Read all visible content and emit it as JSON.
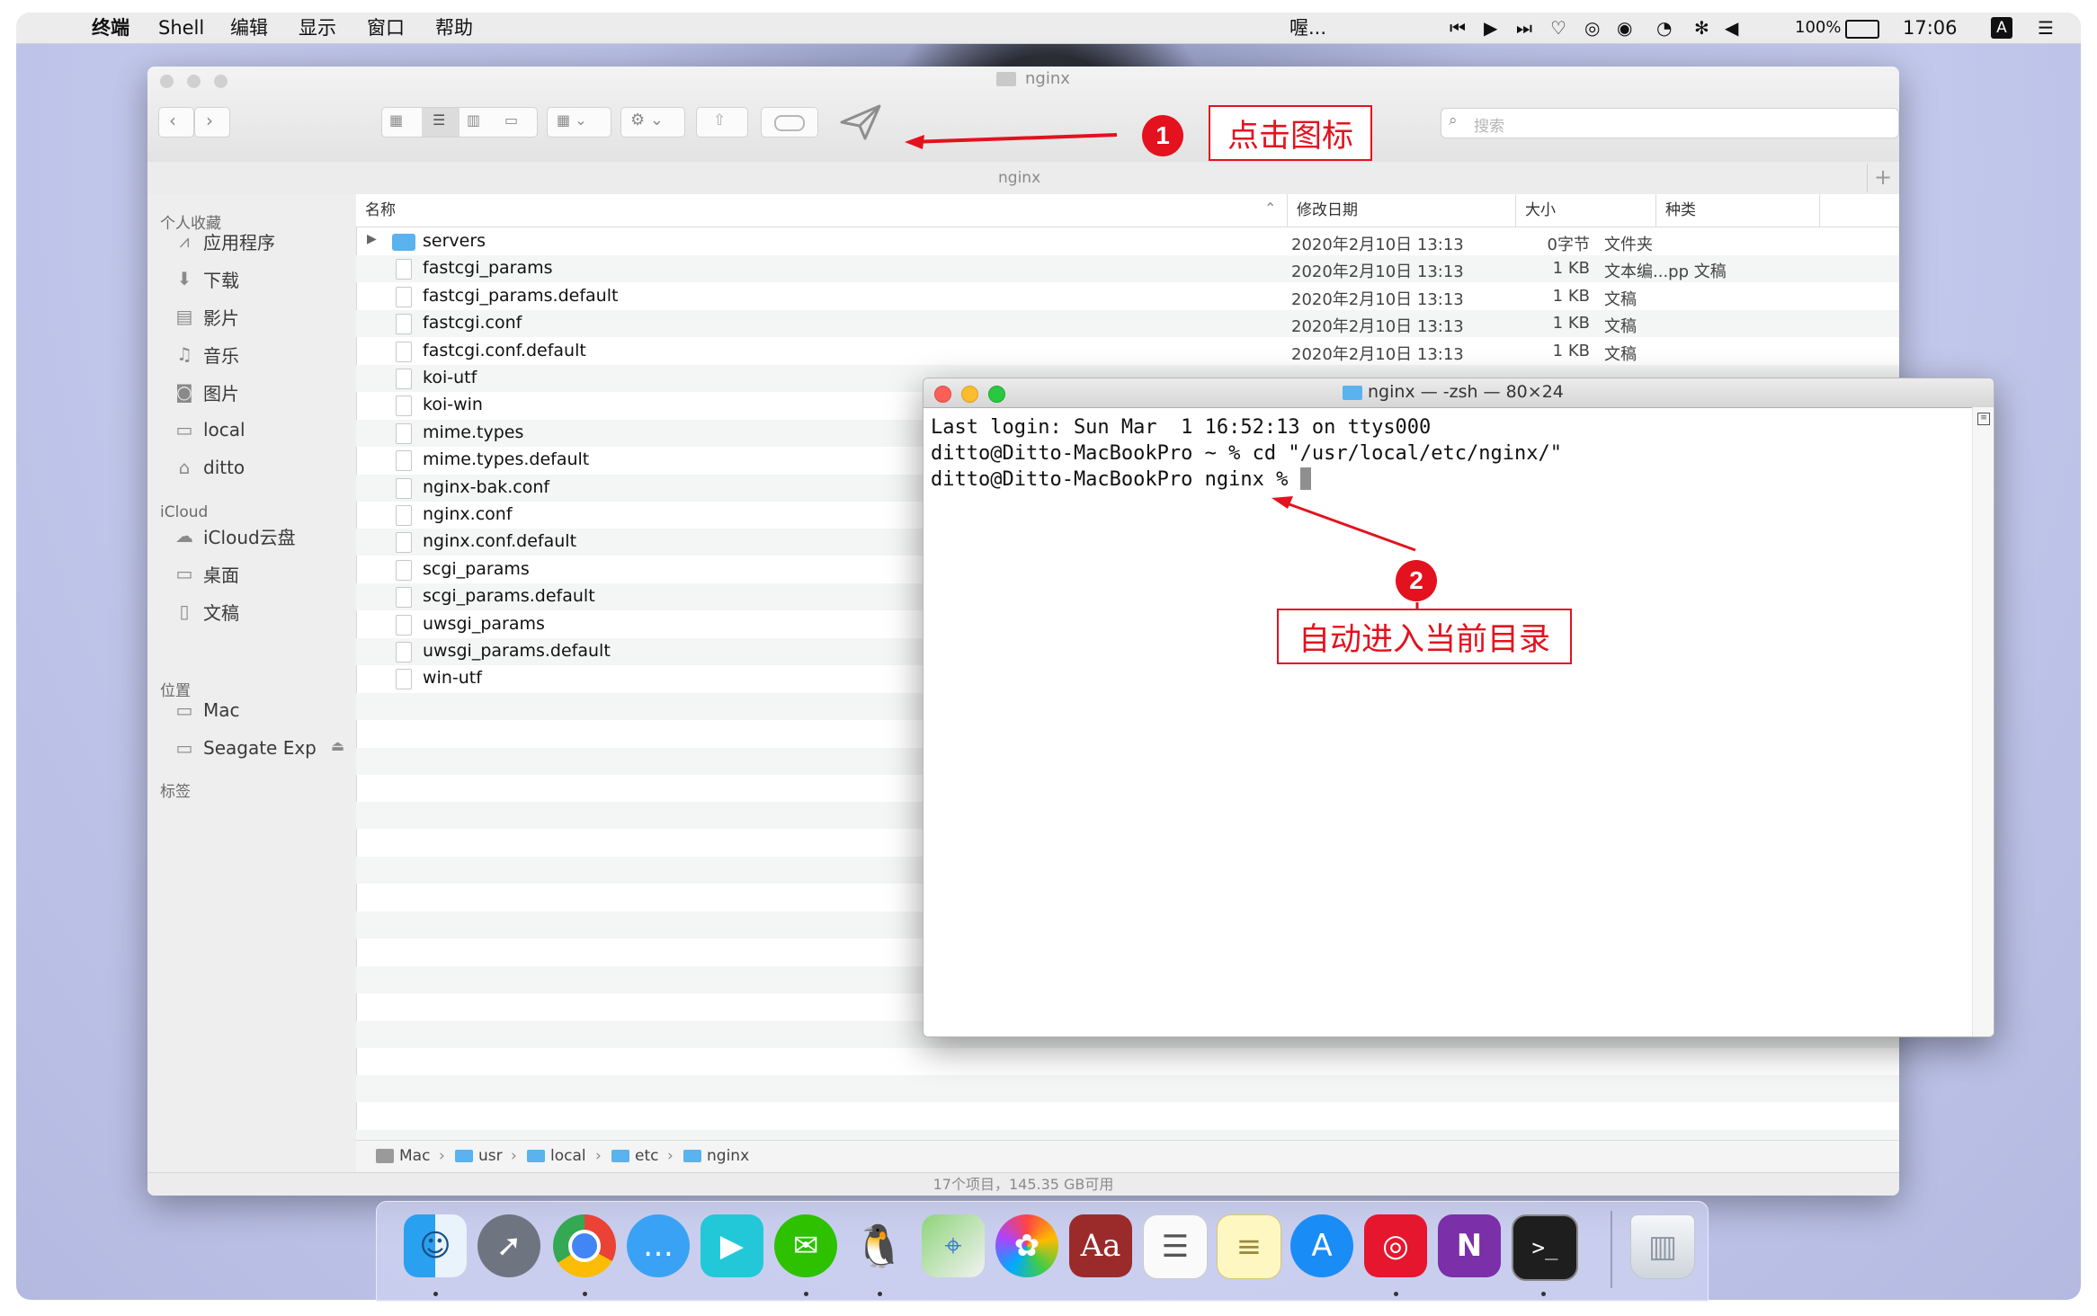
{
  "menubar": {
    "app_name": "终端",
    "menus": [
      "Shell",
      "编辑",
      "显示",
      "窗口",
      "帮助"
    ],
    "now_playing": "喔...",
    "battery": "100%",
    "clock": "17:06",
    "input_method": "A"
  },
  "finder": {
    "window_title": "nginx",
    "path_title": "nginx",
    "search_placeholder": "搜索",
    "sidebar": {
      "favorites_header": "个人收藏",
      "favorites": [
        {
          "label": "应用程序",
          "icon": "applications-icon"
        },
        {
          "label": "下载",
          "icon": "download-icon"
        },
        {
          "label": "影片",
          "icon": "movies-icon"
        },
        {
          "label": "音乐",
          "icon": "music-icon"
        },
        {
          "label": "图片",
          "icon": "camera-icon"
        },
        {
          "label": "local",
          "icon": "folder-icon"
        },
        {
          "label": "ditto",
          "icon": "home-icon"
        }
      ],
      "icloud_header": "iCloud",
      "icloud": [
        {
          "label": "iCloud云盘",
          "icon": "cloud-icon"
        },
        {
          "label": "桌面",
          "icon": "desktop-icon"
        },
        {
          "label": "文稿",
          "icon": "documents-icon"
        }
      ],
      "locations_header": "位置",
      "locations": [
        {
          "label": "Mac",
          "icon": "disk-icon"
        },
        {
          "label": "Seagate Exp",
          "icon": "external-disk-icon"
        }
      ],
      "tags_header": "标签"
    },
    "columns": {
      "name": "名称",
      "date": "修改日期",
      "size": "大小",
      "kind": "种类"
    },
    "files": [
      {
        "name": "servers",
        "date": "2020年2月10日 13:13",
        "size": "0字节",
        "kind": "文件夹",
        "folder": true
      },
      {
        "name": "fastcgi_params",
        "date": "2020年2月10日 13:13",
        "size": "1 KB",
        "kind": "文本编...pp 文稿"
      },
      {
        "name": "fastcgi_params.default",
        "date": "2020年2月10日 13:13",
        "size": "1 KB",
        "kind": "文稿"
      },
      {
        "name": "fastcgi.conf",
        "date": "2020年2月10日 13:13",
        "size": "1 KB",
        "kind": "文稿"
      },
      {
        "name": "fastcgi.conf.default",
        "date": "2020年2月10日 13:13",
        "size": "1 KB",
        "kind": "文稿"
      },
      {
        "name": "koi-utf"
      },
      {
        "name": "koi-win"
      },
      {
        "name": "mime.types"
      },
      {
        "name": "mime.types.default"
      },
      {
        "name": "nginx-bak.conf"
      },
      {
        "name": "nginx.conf"
      },
      {
        "name": "nginx.conf.default"
      },
      {
        "name": "scgi_params"
      },
      {
        "name": "scgi_params.default"
      },
      {
        "name": "uwsgi_params"
      },
      {
        "name": "uwsgi_params.default"
      },
      {
        "name": "win-utf"
      }
    ],
    "breadcrumb": [
      "Mac",
      "usr",
      "local",
      "etc",
      "nginx"
    ],
    "status": "17个项目，145.35 GB可用"
  },
  "terminal": {
    "title": "nginx — -zsh — 80×24",
    "lines": [
      "Last login: Sun Mar  1 16:52:13 on ttys000",
      "ditto@Ditto-MacBookPro ~ % cd \"/usr/local/etc/nginx/\"",
      "ditto@Ditto-MacBookPro nginx % "
    ]
  },
  "annotations": {
    "step1_number": "1",
    "step1_text": "点击图标",
    "step2_number": "2",
    "step2_text": "自动进入当前目录",
    "color": "#e3121e"
  },
  "dock": {
    "apps": [
      "finder-icon",
      "launchpad-icon",
      "chrome-icon",
      "messages-icon",
      "video-player-icon",
      "wechat-icon",
      "qq-icon",
      "maps-icon",
      "photos-icon",
      "dictionary-icon",
      "reminders-icon",
      "notes-icon",
      "app-store-icon",
      "netease-music-icon",
      "onenote-icon",
      "terminal-icon",
      "trash-icon"
    ],
    "dictionary_label": "Aa",
    "onenote_label": "N",
    "terminal_label": ">_"
  }
}
